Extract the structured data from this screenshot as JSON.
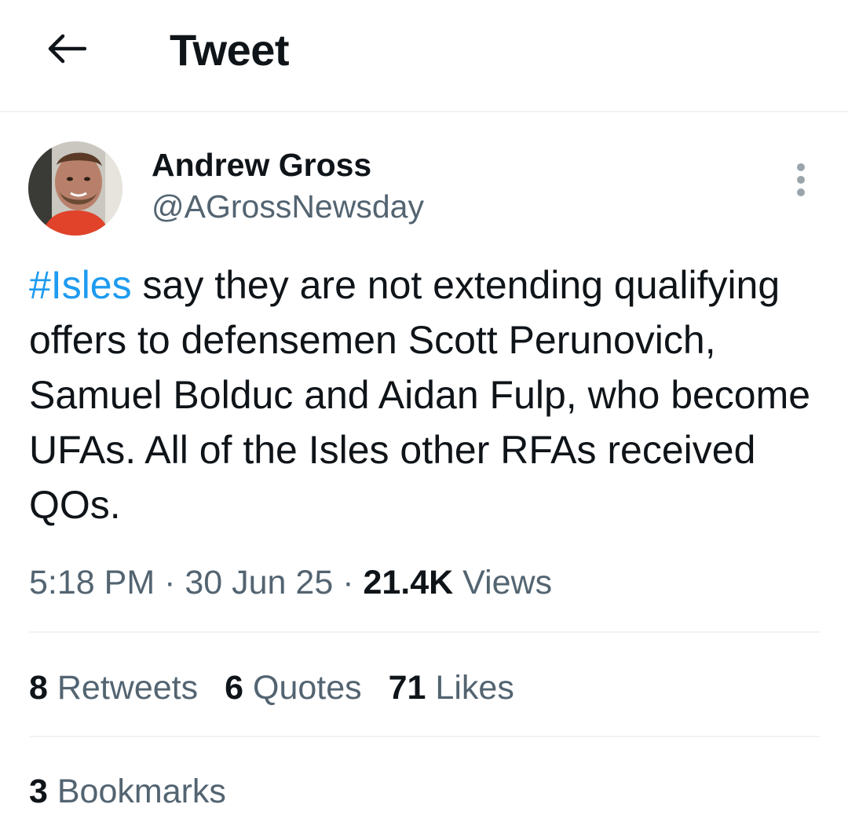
{
  "header": {
    "back_icon": "arrow-left-icon",
    "title": "Tweet"
  },
  "tweet": {
    "author": {
      "name": "Andrew Gross",
      "handle": "@AGrossNewsday"
    },
    "more_icon": "more-vertical-icon",
    "text": {
      "hashtag": "#Isles",
      "body": " say they are not extending qualifying offers to defensemen Scott Perunovich, Samuel Bolduc and Aidan Fulp, who become UFAs. All of the Isles other RFAs received QOs."
    },
    "meta": {
      "time": "5:18 PM",
      "dot": " · ",
      "date": "30 Jun 25",
      "views_count": "21.4K",
      "views_label": " Views"
    },
    "stats": {
      "retweets_count": "8",
      "retweets_label": " Retweets",
      "quotes_count": "6",
      "quotes_label": " Quotes",
      "likes_count": "71",
      "likes_label": " Likes",
      "bookmarks_count": "3",
      "bookmarks_label": " Bookmarks"
    }
  },
  "colors": {
    "accent": "#1d9bf0",
    "secondary_text": "#536471",
    "primary_text": "#0f1419",
    "divider": "#eff3f4"
  }
}
